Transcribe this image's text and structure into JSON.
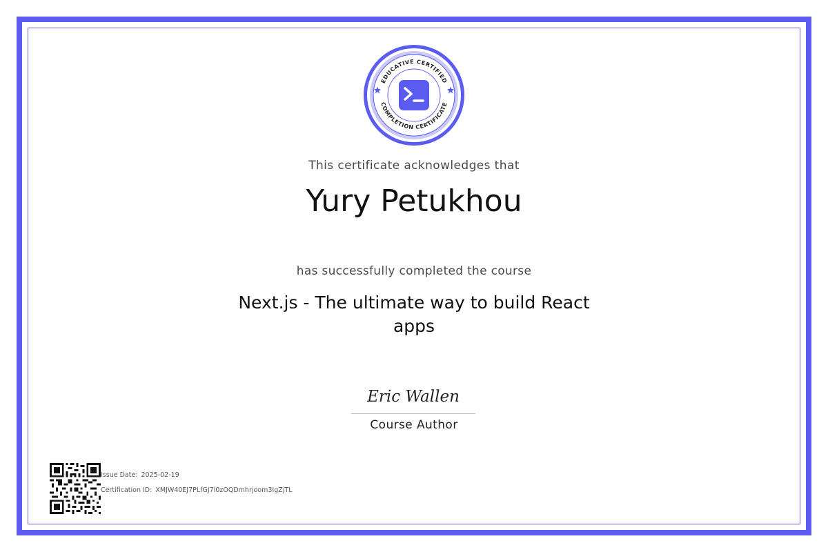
{
  "badge": {
    "top_text": "EDUCATIVE CERTIFIED",
    "bottom_text": "COMPLETION CERTIFICATE",
    "icon": "terminal-prompt-icon",
    "colors": {
      "accent": "#5b5bf0",
      "ring_light": "#c9c9fb",
      "star": "#5b5bf0"
    }
  },
  "certificate": {
    "intro": "This certificate acknowledges that",
    "recipient": "Yury Petukhou",
    "completed_text": "has successfully completed the course",
    "course_title": "Next.js - The ultimate way to build React apps"
  },
  "signature": {
    "name": "Eric Wallen",
    "role": "Course Author"
  },
  "meta": {
    "issue_date_label": "Issue Date:",
    "issue_date": "2025-02-19",
    "cert_id_label": "Certification ID:",
    "cert_id": "XMJW40EJ7PLfGJ7l0zOQDmhrjoom3IgZjTL"
  },
  "colors": {
    "border": "#5b5bf0",
    "text": "#222222",
    "muted": "#4a4a4a"
  }
}
